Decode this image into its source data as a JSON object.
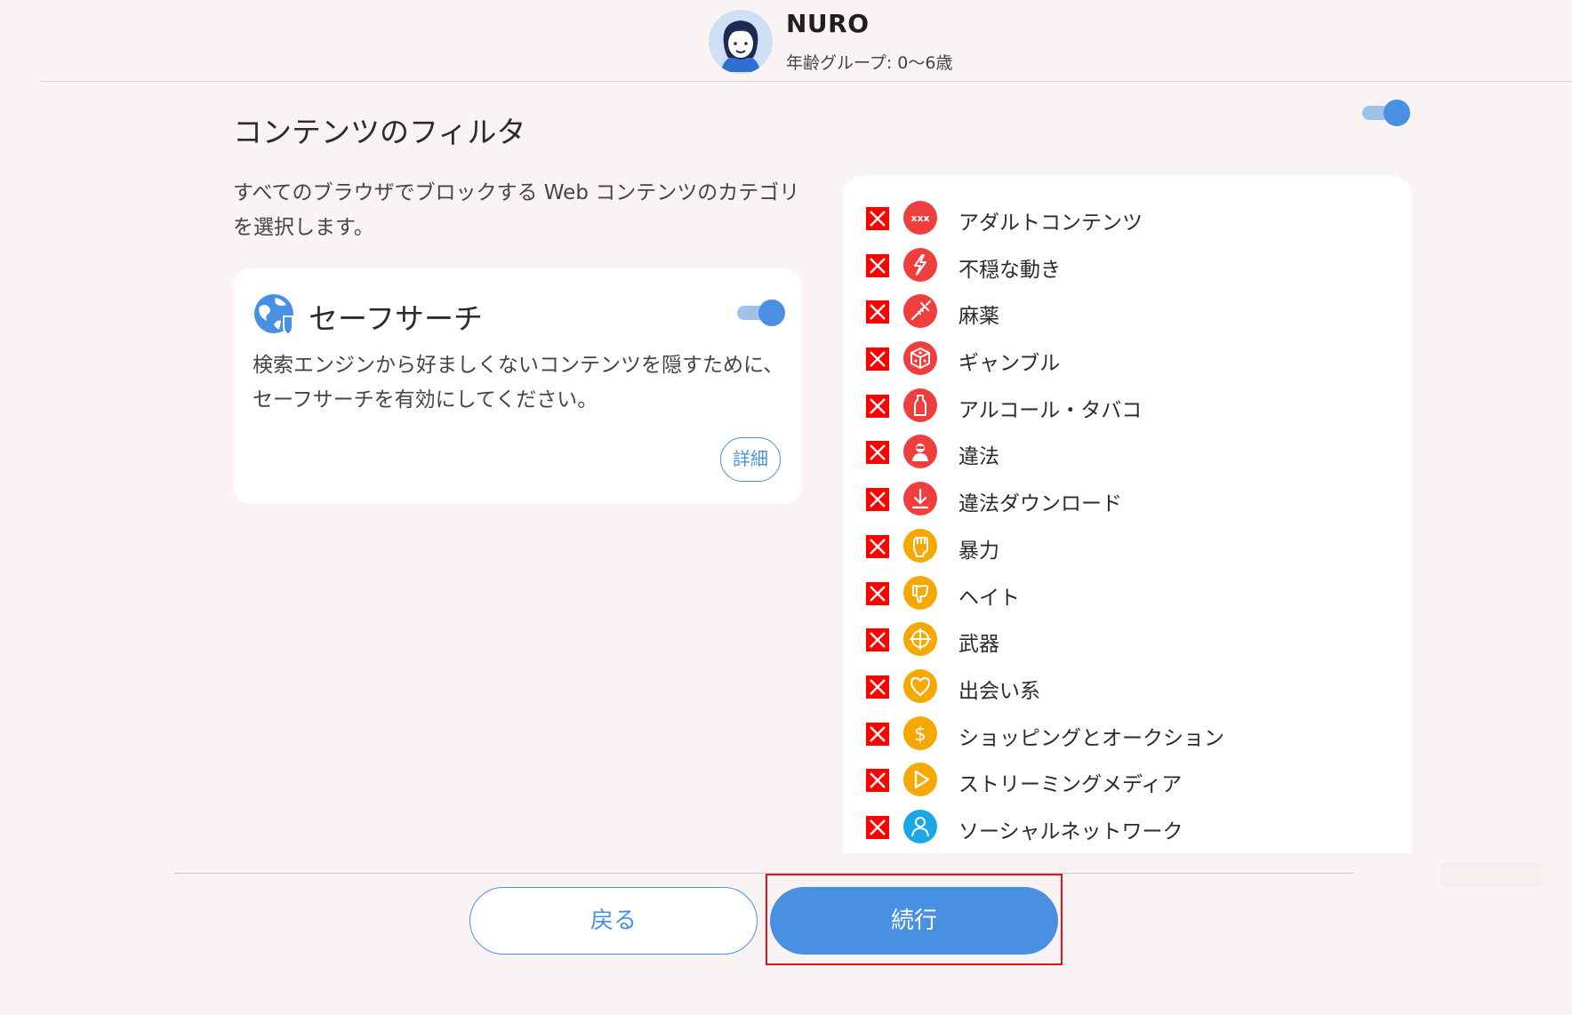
{
  "profile": {
    "name": "NURO",
    "age_group": "年齢グループ: 0〜6歳"
  },
  "content_filter": {
    "title": "コンテンツのフィルタ",
    "enabled": true,
    "description": "すべてのブラウザでブロックする Web コンテンツのカテゴリを選択します。"
  },
  "safe_search": {
    "title": "セーフサーチ",
    "enabled": true,
    "description": "検索エンジンから好ましくないコンテンツを隠すために、セーフサーチを有効にしてください。",
    "details_label": "詳細"
  },
  "categories": [
    {
      "label": "アダルトコンテンツ",
      "icon": "xxx-icon",
      "color": "#ef3e3e",
      "blocked": true
    },
    {
      "label": "不穏な動き",
      "icon": "lightning-icon",
      "color": "#ef3e3e",
      "blocked": true
    },
    {
      "label": "麻薬",
      "icon": "syringe-icon",
      "color": "#ef3e3e",
      "blocked": true
    },
    {
      "label": "ギャンブル",
      "icon": "dice-icon",
      "color": "#ef3e3e",
      "blocked": true
    },
    {
      "label": "アルコール・タバコ",
      "icon": "bottle-icon",
      "color": "#ef3e3e",
      "blocked": true
    },
    {
      "label": "違法",
      "icon": "criminal-icon",
      "color": "#ef3e3e",
      "blocked": true
    },
    {
      "label": "違法ダウンロード",
      "icon": "download-icon",
      "color": "#ef3e3e",
      "blocked": true
    },
    {
      "label": "暴力",
      "icon": "fist-icon",
      "color": "#f5a800",
      "blocked": true
    },
    {
      "label": "ヘイト",
      "icon": "thumbs-down-icon",
      "color": "#f5a800",
      "blocked": true
    },
    {
      "label": "武器",
      "icon": "crosshair-icon",
      "color": "#f5a800",
      "blocked": true
    },
    {
      "label": "出会い系",
      "icon": "heart-icon",
      "color": "#f5a800",
      "blocked": true
    },
    {
      "label": "ショッピングとオークション",
      "icon": "dollar-icon",
      "color": "#f5a800",
      "blocked": true
    },
    {
      "label": "ストリーミングメディア",
      "icon": "play-icon",
      "color": "#f5a800",
      "blocked": true
    },
    {
      "label": "ソーシャルネットワーク",
      "icon": "person-icon",
      "color": "#1aa7e8",
      "blocked": true
    }
  ],
  "footer": {
    "back_label": "戻る",
    "continue_label": "続行"
  },
  "colors": {
    "accent": "#4a90e2",
    "block_red": "#ff0000",
    "highlight": "#e5121b"
  }
}
